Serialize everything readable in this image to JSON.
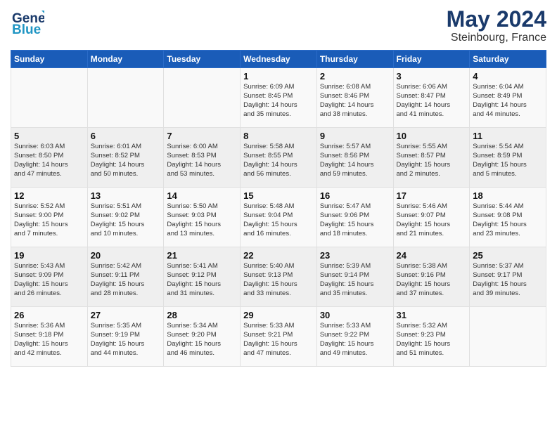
{
  "header": {
    "logo_general": "General",
    "logo_blue": "Blue",
    "month": "May 2024",
    "location": "Steinbourg, France"
  },
  "days_of_week": [
    "Sunday",
    "Monday",
    "Tuesday",
    "Wednesday",
    "Thursday",
    "Friday",
    "Saturday"
  ],
  "weeks": [
    [
      {
        "day": "",
        "content": ""
      },
      {
        "day": "",
        "content": ""
      },
      {
        "day": "",
        "content": ""
      },
      {
        "day": "1",
        "content": "Sunrise: 6:09 AM\nSunset: 8:45 PM\nDaylight: 14 hours\nand 35 minutes."
      },
      {
        "day": "2",
        "content": "Sunrise: 6:08 AM\nSunset: 8:46 PM\nDaylight: 14 hours\nand 38 minutes."
      },
      {
        "day": "3",
        "content": "Sunrise: 6:06 AM\nSunset: 8:47 PM\nDaylight: 14 hours\nand 41 minutes."
      },
      {
        "day": "4",
        "content": "Sunrise: 6:04 AM\nSunset: 8:49 PM\nDaylight: 14 hours\nand 44 minutes."
      }
    ],
    [
      {
        "day": "5",
        "content": "Sunrise: 6:03 AM\nSunset: 8:50 PM\nDaylight: 14 hours\nand 47 minutes."
      },
      {
        "day": "6",
        "content": "Sunrise: 6:01 AM\nSunset: 8:52 PM\nDaylight: 14 hours\nand 50 minutes."
      },
      {
        "day": "7",
        "content": "Sunrise: 6:00 AM\nSunset: 8:53 PM\nDaylight: 14 hours\nand 53 minutes."
      },
      {
        "day": "8",
        "content": "Sunrise: 5:58 AM\nSunset: 8:55 PM\nDaylight: 14 hours\nand 56 minutes."
      },
      {
        "day": "9",
        "content": "Sunrise: 5:57 AM\nSunset: 8:56 PM\nDaylight: 14 hours\nand 59 minutes."
      },
      {
        "day": "10",
        "content": "Sunrise: 5:55 AM\nSunset: 8:57 PM\nDaylight: 15 hours\nand 2 minutes."
      },
      {
        "day": "11",
        "content": "Sunrise: 5:54 AM\nSunset: 8:59 PM\nDaylight: 15 hours\nand 5 minutes."
      }
    ],
    [
      {
        "day": "12",
        "content": "Sunrise: 5:52 AM\nSunset: 9:00 PM\nDaylight: 15 hours\nand 7 minutes."
      },
      {
        "day": "13",
        "content": "Sunrise: 5:51 AM\nSunset: 9:02 PM\nDaylight: 15 hours\nand 10 minutes."
      },
      {
        "day": "14",
        "content": "Sunrise: 5:50 AM\nSunset: 9:03 PM\nDaylight: 15 hours\nand 13 minutes."
      },
      {
        "day": "15",
        "content": "Sunrise: 5:48 AM\nSunset: 9:04 PM\nDaylight: 15 hours\nand 16 minutes."
      },
      {
        "day": "16",
        "content": "Sunrise: 5:47 AM\nSunset: 9:06 PM\nDaylight: 15 hours\nand 18 minutes."
      },
      {
        "day": "17",
        "content": "Sunrise: 5:46 AM\nSunset: 9:07 PM\nDaylight: 15 hours\nand 21 minutes."
      },
      {
        "day": "18",
        "content": "Sunrise: 5:44 AM\nSunset: 9:08 PM\nDaylight: 15 hours\nand 23 minutes."
      }
    ],
    [
      {
        "day": "19",
        "content": "Sunrise: 5:43 AM\nSunset: 9:09 PM\nDaylight: 15 hours\nand 26 minutes."
      },
      {
        "day": "20",
        "content": "Sunrise: 5:42 AM\nSunset: 9:11 PM\nDaylight: 15 hours\nand 28 minutes."
      },
      {
        "day": "21",
        "content": "Sunrise: 5:41 AM\nSunset: 9:12 PM\nDaylight: 15 hours\nand 31 minutes."
      },
      {
        "day": "22",
        "content": "Sunrise: 5:40 AM\nSunset: 9:13 PM\nDaylight: 15 hours\nand 33 minutes."
      },
      {
        "day": "23",
        "content": "Sunrise: 5:39 AM\nSunset: 9:14 PM\nDaylight: 15 hours\nand 35 minutes."
      },
      {
        "day": "24",
        "content": "Sunrise: 5:38 AM\nSunset: 9:16 PM\nDaylight: 15 hours\nand 37 minutes."
      },
      {
        "day": "25",
        "content": "Sunrise: 5:37 AM\nSunset: 9:17 PM\nDaylight: 15 hours\nand 39 minutes."
      }
    ],
    [
      {
        "day": "26",
        "content": "Sunrise: 5:36 AM\nSunset: 9:18 PM\nDaylight: 15 hours\nand 42 minutes."
      },
      {
        "day": "27",
        "content": "Sunrise: 5:35 AM\nSunset: 9:19 PM\nDaylight: 15 hours\nand 44 minutes."
      },
      {
        "day": "28",
        "content": "Sunrise: 5:34 AM\nSunset: 9:20 PM\nDaylight: 15 hours\nand 46 minutes."
      },
      {
        "day": "29",
        "content": "Sunrise: 5:33 AM\nSunset: 9:21 PM\nDaylight: 15 hours\nand 47 minutes."
      },
      {
        "day": "30",
        "content": "Sunrise: 5:33 AM\nSunset: 9:22 PM\nDaylight: 15 hours\nand 49 minutes."
      },
      {
        "day": "31",
        "content": "Sunrise: 5:32 AM\nSunset: 9:23 PM\nDaylight: 15 hours\nand 51 minutes."
      },
      {
        "day": "",
        "content": ""
      }
    ]
  ]
}
